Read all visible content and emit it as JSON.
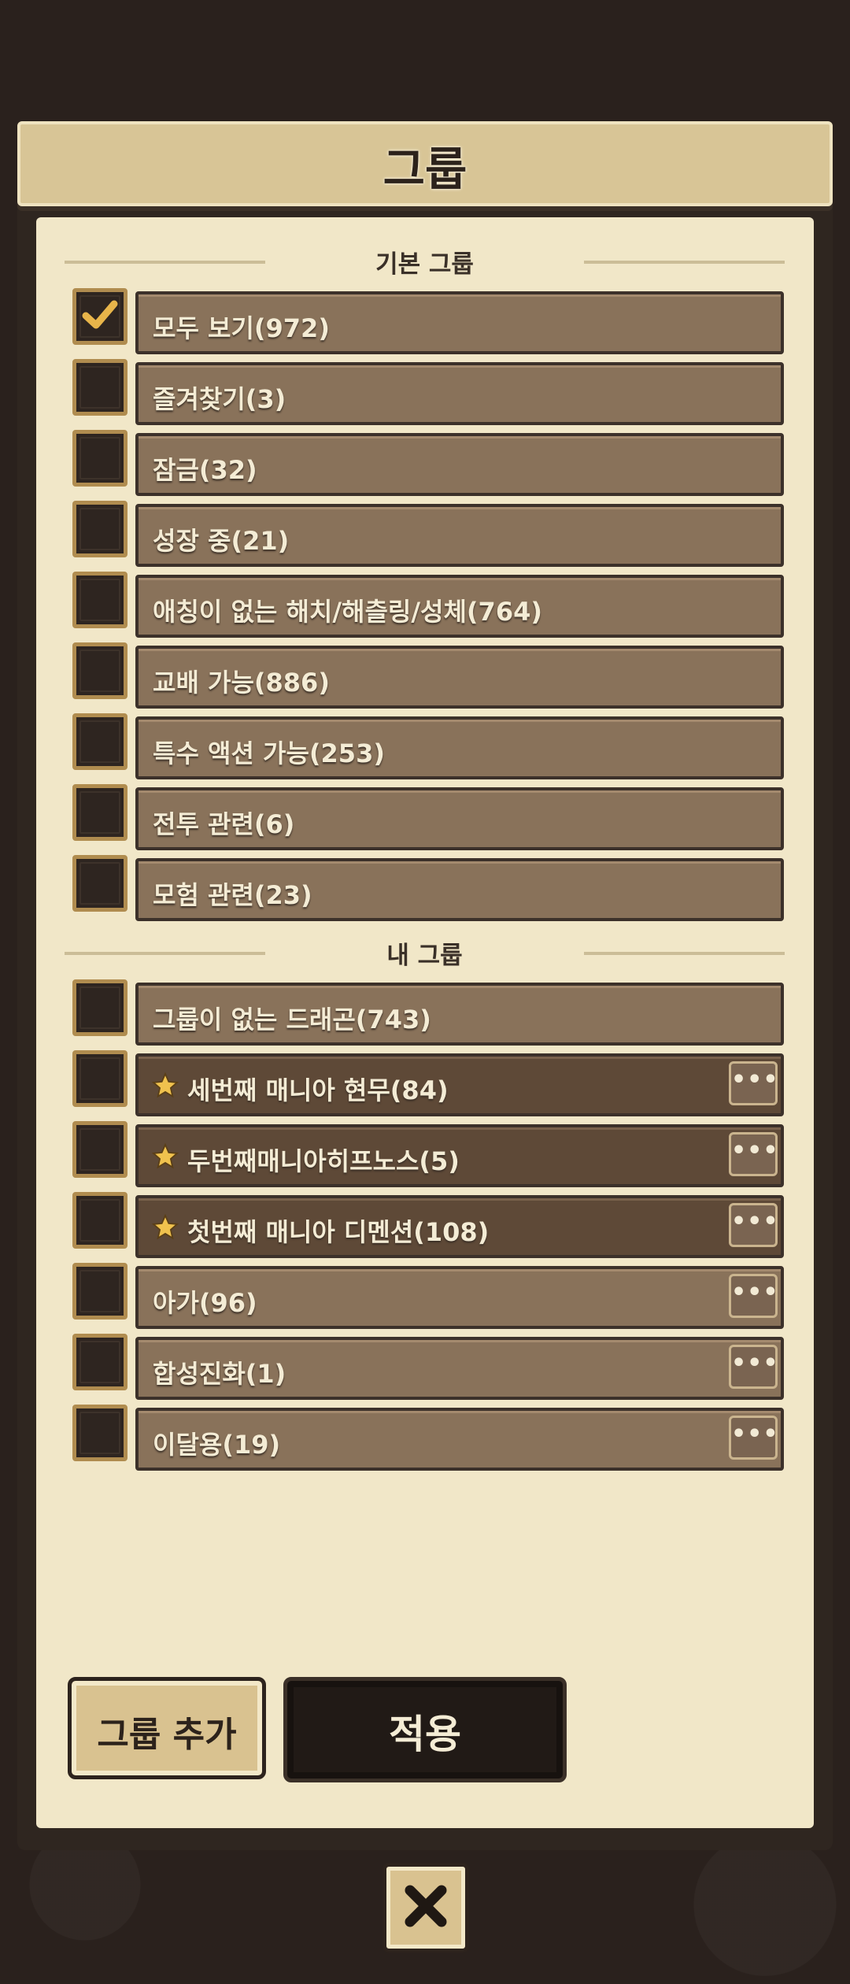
{
  "header": {
    "title": "그룹"
  },
  "basic_section": {
    "label": "기본 그룹"
  },
  "my_section": {
    "label": "내 그룹"
  },
  "basic_groups": [
    {
      "label": "모두 보기(972)",
      "checked": true
    },
    {
      "label": "즐겨찾기(3)",
      "checked": false
    },
    {
      "label": "잠금(32)",
      "checked": false
    },
    {
      "label": "성장 중(21)",
      "checked": false
    },
    {
      "label": "애칭이 없는 해치/해츨링/성체(764)",
      "checked": false
    },
    {
      "label": "교배 가능(886)",
      "checked": false
    },
    {
      "label": "특수 액션 가능(253)",
      "checked": false
    },
    {
      "label": "전투 관련(6)",
      "checked": false
    },
    {
      "label": "모험 관련(23)",
      "checked": false
    }
  ],
  "my_groups": [
    {
      "label": "그룹이 없는 드래곤(743)",
      "checked": false,
      "starred": false,
      "has_menu": false
    },
    {
      "label": "세번째 매니아 현무(84)",
      "checked": false,
      "starred": true,
      "has_menu": true
    },
    {
      "label": "두번째매니아히프노스(5)",
      "checked": false,
      "starred": true,
      "has_menu": true
    },
    {
      "label": "첫번째 매니아 디멘션(108)",
      "checked": false,
      "starred": true,
      "has_menu": true
    },
    {
      "label": "아가(96)",
      "checked": false,
      "starred": false,
      "has_menu": true
    },
    {
      "label": "합성진화(1)",
      "checked": false,
      "starred": false,
      "has_menu": true
    },
    {
      "label": "이달용(19)",
      "checked": false,
      "starred": false,
      "has_menu": true
    }
  ],
  "more_label": "•••",
  "buttons": {
    "add_group": "그룹 추가",
    "apply": "적용"
  },
  "icons": {
    "check": "check-icon",
    "star": "star-icon",
    "close": "close-icon",
    "more": "more-icon"
  },
  "colors": {
    "accent": "#e8b54a",
    "row": "#89725a",
    "row_starred": "#5e4937"
  }
}
